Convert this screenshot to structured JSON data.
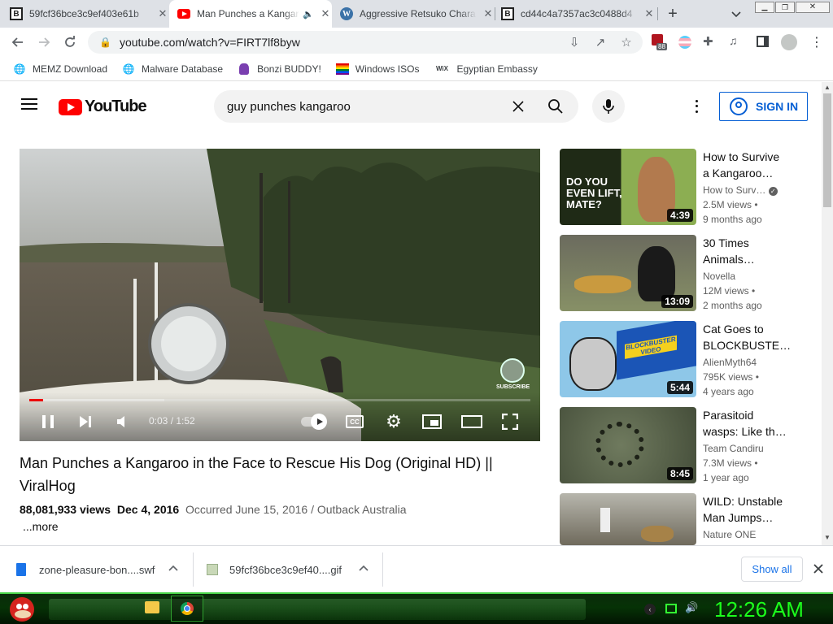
{
  "tabs": [
    {
      "title": "59fcf36bce3c9ef403e61b",
      "favicon": "bandcamp-b-icon",
      "active": false
    },
    {
      "title": "Man Punches a Kangaroo",
      "favicon": "youtube-icon",
      "active": true,
      "audio": true
    },
    {
      "title": "Aggressive Retsuko Chara",
      "favicon": "wordpress-icon",
      "active": false
    },
    {
      "title": "cd44c4a7357ac3c0488d4",
      "favicon": "bandcamp-b-icon",
      "active": false
    }
  ],
  "toolbar": {
    "url": "youtube.com/watch?v=FIRT7lf8byw",
    "extension_badge": "88"
  },
  "bookmarks": [
    {
      "label": "MEMZ Download",
      "icon": "globe-icon"
    },
    {
      "label": "Malware Database",
      "icon": "globe-icon"
    },
    {
      "label": "Bonzi BUDDY!",
      "icon": "bonzi-icon"
    },
    {
      "label": "Windows ISOs",
      "icon": "rainbow-icon"
    },
    {
      "label": "Egyptian Embassy",
      "icon": "wix-icon"
    }
  ],
  "youtube": {
    "logo_text": "YouTube",
    "search_query": "guy punches kangaroo",
    "sign_in": "SIGN IN"
  },
  "player": {
    "current_time": "0:03",
    "duration": "1:52",
    "played_fraction": 0.027,
    "buffered_fraction": 0.27,
    "watermark": "SUBSCRIBE"
  },
  "video": {
    "title": "Man Punches a Kangaroo in the Face to Rescue His Dog (Original HD) || ViralHog",
    "views": "88,081,933 views",
    "date": "Dec 4, 2016",
    "occurred": "Occurred June 15, 2016 / Outback Australia",
    "more": "...more"
  },
  "related": [
    {
      "title": "How to Survive\na Kangaroo…",
      "channel": "How to Surv…",
      "verified": true,
      "views": "2.5M views •",
      "ago": "9 months ago",
      "duration": "4:39",
      "thumb_text": "DO YOU EVEN LIFT, MATE?"
    },
    {
      "title": "30 Times\nAnimals…",
      "channel": "Novella",
      "verified": false,
      "views": "12M views •",
      "ago": "2 months ago",
      "duration": "13:09"
    },
    {
      "title": "Cat Goes to\nBLOCKBUSTE…",
      "channel": "AlienMyth64",
      "verified": false,
      "views": "795K views •",
      "ago": "4 years ago",
      "duration": "5:44",
      "thumb_text": "BLOCKBUSTER VIDEO"
    },
    {
      "title": "Parasitoid\nwasps: Like th…",
      "channel": "Team Candiru",
      "verified": false,
      "views": "7.3M views •",
      "ago": "1 year ago",
      "duration": "8:45"
    },
    {
      "title": "WILD: Unstable\nMan Jumps…",
      "channel": "Nature ONE",
      "verified": false,
      "views": "",
      "ago": "",
      "duration": ""
    }
  ],
  "downloads": [
    {
      "name": "zone-pleasure-bon....swf",
      "icon": "file-icon"
    },
    {
      "name": "59fcf36bce3c9ef40....gif",
      "icon": "image-file-icon"
    }
  ],
  "download_bar": {
    "show_all": "Show all"
  },
  "taskbar": {
    "clock": "12:26 AM"
  },
  "colors": {
    "youtube_red": "#ff0000",
    "link_blue": "#065fd4",
    "clock_green": "#1cff1c",
    "tab_strip": "#dee1e6"
  }
}
